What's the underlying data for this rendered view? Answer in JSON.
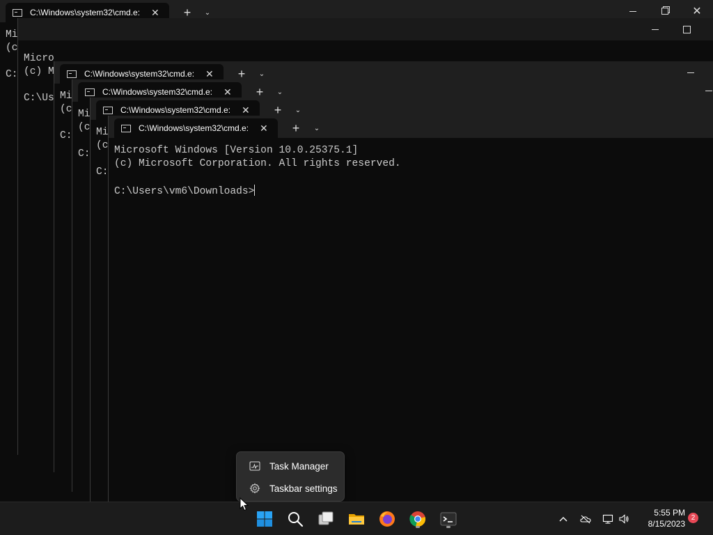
{
  "tab_title": "C:\\Windows\\system32\\cmd.e:",
  "tab_close_glyph": "✕",
  "new_tab_glyph": "+",
  "dropdown_glyph": "⌄",
  "back_windows": [
    {
      "lines": [
        "Mi",
        "(c",
        "",
        "C:"
      ]
    },
    {
      "lines": [
        "Micro",
        "(c) M",
        "",
        "C:\\Us"
      ]
    },
    {
      "lines": [
        "Mi",
        "(c",
        "",
        "C:"
      ]
    },
    {
      "lines": [
        "Mi",
        "(c",
        "",
        "C:"
      ]
    },
    {
      "lines": [
        "Mi",
        "(c",
        "",
        "C:"
      ]
    }
  ],
  "front_window": {
    "lines": [
      "Microsoft Windows [Version 10.0.25375.1]",
      "(c) Microsoft Corporation. All rights reserved.",
      "",
      "C:\\Users\\vm6\\Downloads>"
    ]
  },
  "context_menu": {
    "items": [
      {
        "label": "Task Manager",
        "icon": "task-manager-icon"
      },
      {
        "label": "Taskbar settings",
        "icon": "gear-icon"
      }
    ]
  },
  "taskbar": {
    "apps": [
      "start-icon",
      "search-icon",
      "task-view-icon",
      "file-explorer-icon",
      "firefox-icon",
      "chrome-icon",
      "terminal-icon"
    ],
    "tray": [
      "chevron-up-icon",
      "onedrive-icon",
      "network-icon",
      "volume-icon"
    ],
    "time": "5:55 PM",
    "date": "8/15/2023",
    "notification_count": "2"
  },
  "colors": {
    "terminal_bg": "#0c0c0c",
    "titlebar_bg": "#1f1f1f",
    "taskbar_bg": "#1c1c1c",
    "start_blue": "#0078d4",
    "badge_red": "#e74856"
  }
}
